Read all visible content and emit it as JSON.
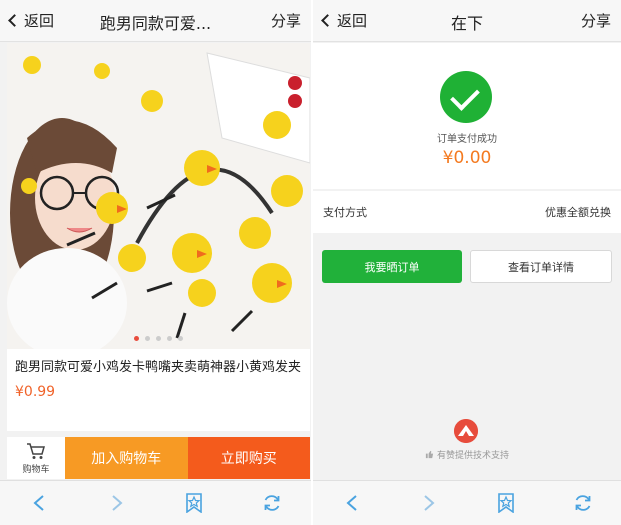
{
  "left": {
    "header": {
      "back_label": "返回",
      "title": "跑男同款可爱...",
      "share_label": "分享"
    },
    "product": {
      "title": "跑男同款可爱小鸡发卡鸭嘴夹卖萌神器小黄鸡发夹",
      "price": "¥0.99",
      "image_icon": "product-photo",
      "carousel_count": 5,
      "carousel_active": 0
    },
    "buybar": {
      "cart_label": "购物车",
      "add_cart_label": "加入购物车",
      "buy_now_label": "立即购买"
    }
  },
  "right": {
    "header": {
      "back_label": "返回",
      "title": "在下",
      "share_label": "分享"
    },
    "success": {
      "text": "订单支付成功",
      "amount": "¥0.00"
    },
    "payment": {
      "label": "支付方式",
      "value": "优惠全额兑换"
    },
    "actions": {
      "share_order": "我要晒订单",
      "view_detail": "查看订单详情"
    },
    "footer": {
      "powered_by": "有赞提供技术支持"
    }
  },
  "colors": {
    "accent_green": "#21b13a",
    "price_orange": "#f47a20",
    "add_cart": "#f79a24",
    "buy_now": "#f45b1c"
  }
}
